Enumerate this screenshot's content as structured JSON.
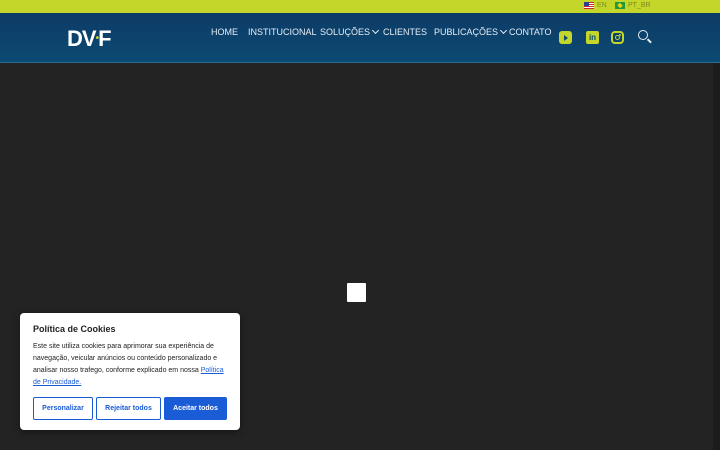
{
  "top_bar": {
    "languages": [
      {
        "code": "EN",
        "flag": "us-flag-icon"
      },
      {
        "code": "PT_BR",
        "flag": "br-flag-icon"
      }
    ]
  },
  "header": {
    "logo_main": "DV",
    "logo_dot": "•",
    "logo_end": "F",
    "nav": [
      {
        "label": "HOME",
        "dropdown": false
      },
      {
        "label": "INSTITUCIONAL",
        "dropdown": false
      },
      {
        "label": "SOLUÇÕES",
        "dropdown": true
      },
      {
        "label": "CLIENTES",
        "dropdown": false
      },
      {
        "label": "PUBLICAÇÕES",
        "dropdown": true
      },
      {
        "label": "CONTATO",
        "dropdown": false
      }
    ],
    "social": [
      "youtube-icon",
      "linkedin-icon",
      "instagram-icon"
    ],
    "linkedin_glyph": "in"
  },
  "cookie_banner": {
    "title": "Política de Cookies",
    "body": "Este site utiliza cookies para aprimorar sua experiência de navegação, veicular anúncios ou conteúdo personalizado e analisar nosso trafego, conforme explicado em nossa ",
    "link_text": "Política de Privacidade.",
    "buttons": {
      "customize": "Personalizar",
      "reject": "Rejeitar todos",
      "accept": "Aceitar todos"
    }
  },
  "colors": {
    "accent": "#c4d62a",
    "nav_bg": "#0d3b66",
    "primary_button": "#1a5bd6",
    "page_bg": "#232323"
  }
}
